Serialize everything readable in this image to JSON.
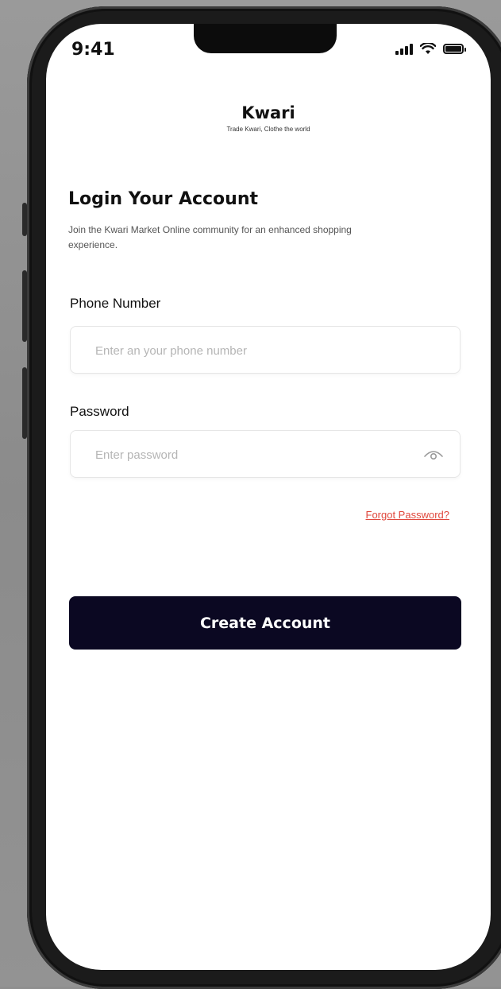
{
  "status_bar": {
    "time": "9:41",
    "icons": [
      "signal-icon",
      "wifi-icon",
      "battery-icon"
    ]
  },
  "brand": {
    "title": "Kwari",
    "tagline": "Trade Kwari, Clothe the world"
  },
  "login": {
    "title": "Login Your Account",
    "subtitle": "Join the Kwari Market Online community for an enhanced shopping experience."
  },
  "phone_field": {
    "label": "Phone Number",
    "placeholder": "Enter an your phone number",
    "value": ""
  },
  "password_field": {
    "label": "Password",
    "placeholder": "Enter password",
    "value": "",
    "icon": "eye-icon"
  },
  "forgot_password": "Forgot Password?",
  "primary_button": "Create Account",
  "colors": {
    "button_bg": "#0b0822",
    "link": "#e0473c",
    "background": "#ffffff"
  }
}
